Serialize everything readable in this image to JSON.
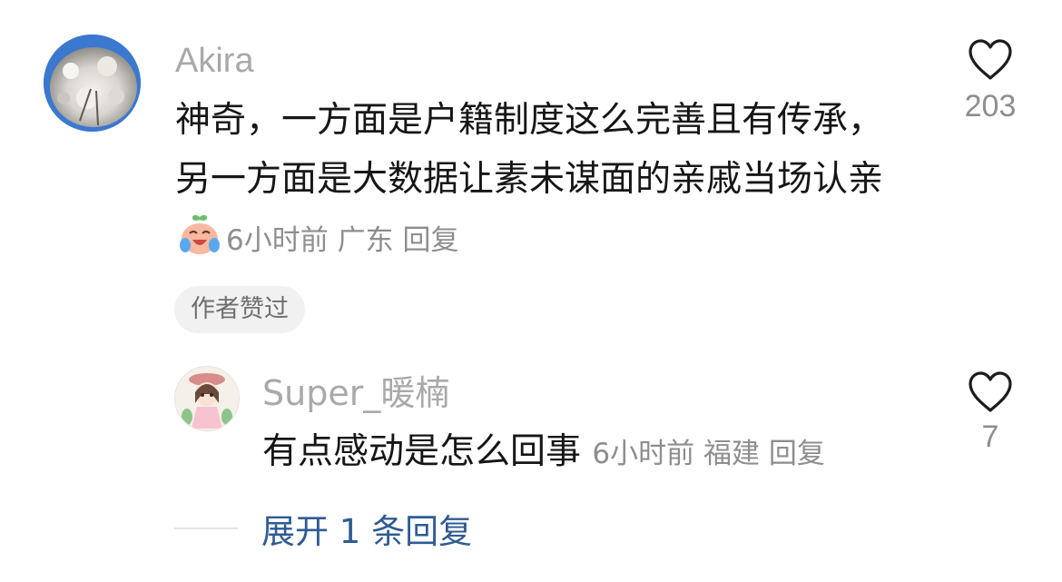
{
  "comment": {
    "username": "Akira",
    "body_text": "神奇，一方面是户籍制度这么完善且有传承，另一方面是大数据让素未谋面的亲戚当场认亲",
    "emoji": "crying-laughing-peach-emoji",
    "time": "6小时前",
    "location": "广东",
    "reply_label": "回复",
    "liked_badge": "作者赞过",
    "like_count": "203"
  },
  "reply": {
    "username": "Super_暖楠",
    "body_text": "有点感动是怎么回事",
    "time": "6小时前",
    "location": "福建",
    "reply_label": "回复",
    "like_count": "7"
  },
  "expand": {
    "label": "展开 1 条回复"
  },
  "colors": {
    "username": "#a9a9a9",
    "body": "#161616",
    "meta": "#8e8e8e",
    "link": "#2f5b94",
    "badge_bg": "#f1f1f1"
  },
  "icons": [
    "heart-outline-icon"
  ]
}
